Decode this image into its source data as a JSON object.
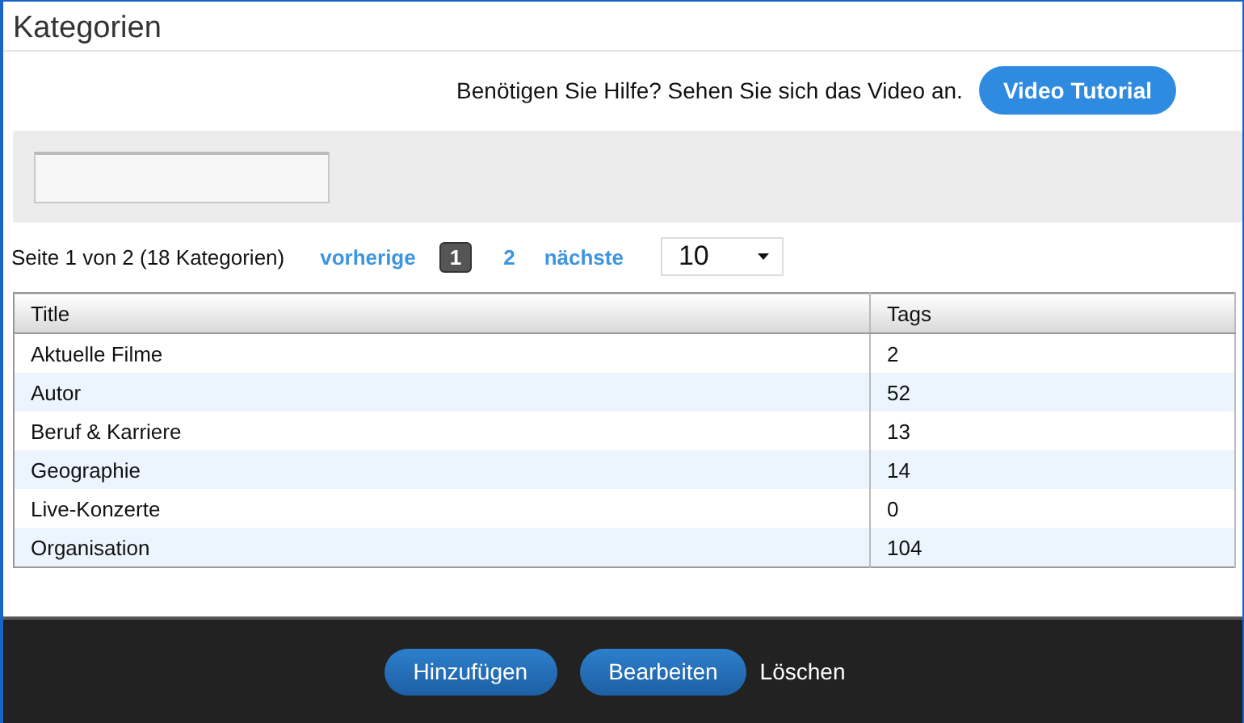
{
  "window": {
    "title": "Kategorien"
  },
  "help": {
    "text": "Benötigen Sie Hilfe? Sehen Sie sich das Video an.",
    "button": "Video Tutorial"
  },
  "pagination": {
    "summary": "Seite 1 von 2 (18 Kategorien)",
    "previous": "vorherige",
    "next": "nächste",
    "pages": [
      {
        "label": "1",
        "selected": true
      },
      {
        "label": "2",
        "selected": false
      }
    ],
    "page_size": "10"
  },
  "table": {
    "columns": [
      "Title",
      "Tags"
    ],
    "rows": [
      [
        "Aktuelle Filme",
        "2"
      ],
      [
        "Autor",
        "52"
      ],
      [
        "Beruf & Karriere",
        "13"
      ],
      [
        "Geographie",
        "14"
      ],
      [
        "Live-Konzerte",
        "0"
      ],
      [
        "Organisation",
        "104"
      ]
    ]
  },
  "footer": [
    {
      "label": "Hinzufügen",
      "kind": "button"
    },
    {
      "label": "Bearbeiten",
      "kind": "button"
    },
    {
      "label": "Löschen",
      "kind": "link"
    }
  ]
}
